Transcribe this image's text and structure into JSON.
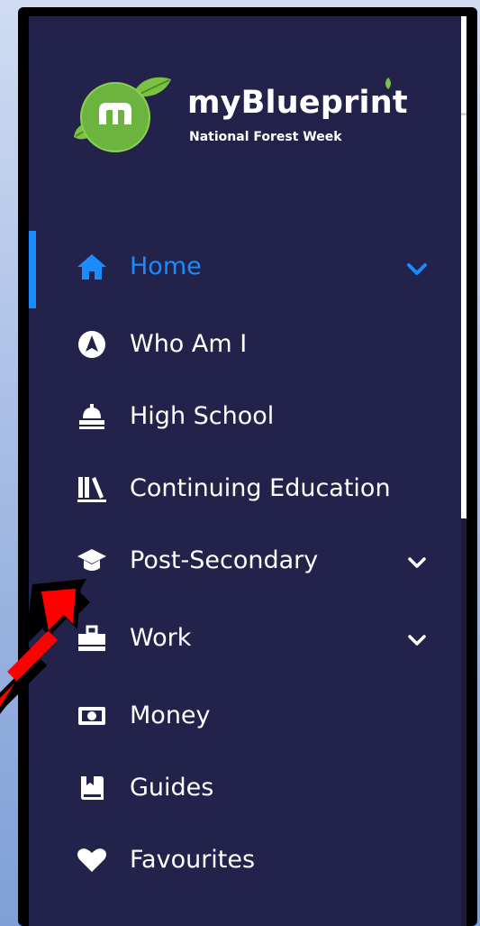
{
  "brand": {
    "name": "myBlueprint",
    "tagline": "National Forest Week",
    "logo_text": "m"
  },
  "nav": {
    "items": [
      {
        "label": "Home",
        "icon": "home-icon",
        "active": true,
        "expandable": true
      },
      {
        "label": "Who Am I",
        "icon": "compass-icon",
        "active": false,
        "expandable": false
      },
      {
        "label": "High School",
        "icon": "school-bell-icon",
        "active": false,
        "expandable": false
      },
      {
        "label": "Continuing Education",
        "icon": "books-icon",
        "active": false,
        "expandable": false
      },
      {
        "label": "Post-Secondary",
        "icon": "graduation-cap-icon",
        "active": false,
        "expandable": true
      },
      {
        "label": "Work",
        "icon": "briefcase-icon",
        "active": false,
        "expandable": true
      },
      {
        "label": "Money",
        "icon": "money-icon",
        "active": false,
        "expandable": false
      },
      {
        "label": "Guides",
        "icon": "guide-book-icon",
        "active": false,
        "expandable": false
      },
      {
        "label": "Favourites",
        "icon": "heart-icon",
        "active": false,
        "expandable": false
      }
    ]
  },
  "colors": {
    "sidebar_bg": "#23224b",
    "accent": "#1a8cff",
    "text": "#ffffff",
    "logo_green": "#7cc242",
    "arrow_red": "#ff0000"
  }
}
